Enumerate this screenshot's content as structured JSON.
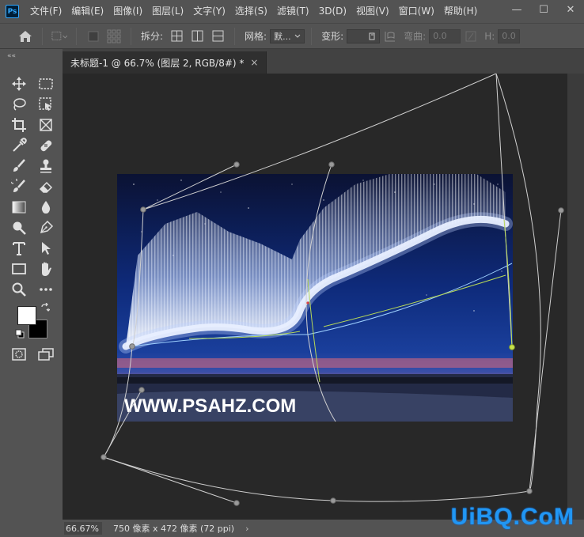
{
  "app": {
    "logo": "Ps"
  },
  "menu": [
    "文件(F)",
    "编辑(E)",
    "图像(I)",
    "图层(L)",
    "文字(Y)",
    "选择(S)",
    "滤镜(T)",
    "3D(D)",
    "视图(V)",
    "窗口(W)",
    "帮助(H)"
  ],
  "window_controls": {
    "minimize": "—",
    "maximize": "☐",
    "close": "✕"
  },
  "options": {
    "split_label": "拆分:",
    "grid_label": "网格:",
    "grid_value": "默...",
    "warp_label": "变形:",
    "bend_label": "弯曲:",
    "bend_value": "0.0",
    "h_label": "H:",
    "h_value": "0.0"
  },
  "document": {
    "tab_title": "未标题-1 @ 66.7% (图层 2, RGB/8#) *",
    "close": "×",
    "image_text": "WWW.PSAHZ.COM"
  },
  "status": {
    "zoom": "66.67%",
    "doc_info": "750 像素 x 472 像素 (72 ppi)",
    "arrow": "›"
  },
  "watermark": {
    "part1": "UiBQ.",
    "part2": "CoM"
  },
  "colors": {
    "accent": "#31a8ff",
    "canvas_bg": "#282828",
    "panel": "#535353"
  }
}
